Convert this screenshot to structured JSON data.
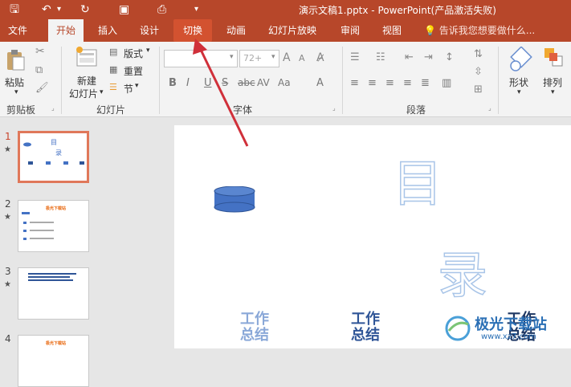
{
  "title": "演示文稿1.pptx - PowerPoint(产品激活失败)",
  "tabs": [
    "文件",
    "开始",
    "插入",
    "设计",
    "切换",
    "动画",
    "幻灯片放映",
    "审阅",
    "视图"
  ],
  "tell_me": "告诉我您想要做什么...",
  "ribbon": {
    "paste": "粘贴",
    "new_slide_line1": "新建",
    "new_slide_line2": "幻灯片",
    "layout": "版式",
    "reset": "重置",
    "section": "节",
    "font_size": "72+",
    "shapes": "形状",
    "arrange": "排列",
    "groups": {
      "clipboard": "剪贴板",
      "slides": "幻灯片",
      "font": "字体",
      "paragraph": "段落"
    }
  },
  "thumbnails": [
    {
      "num": "1",
      "star": "★"
    },
    {
      "num": "2",
      "star": "★",
      "title": "极光下载站"
    },
    {
      "num": "3",
      "star": "★"
    },
    {
      "num": "4",
      "title": "极光下载站"
    }
  ],
  "slide": {
    "char_mu": "目",
    "char_lu": "录",
    "section_lines": [
      "工作",
      "总结"
    ]
  },
  "watermark": {
    "text": "极光下载站",
    "url": "www.xz7.com"
  },
  "colors": {
    "accent": "#b7472a",
    "arrow": "#d0303a"
  }
}
